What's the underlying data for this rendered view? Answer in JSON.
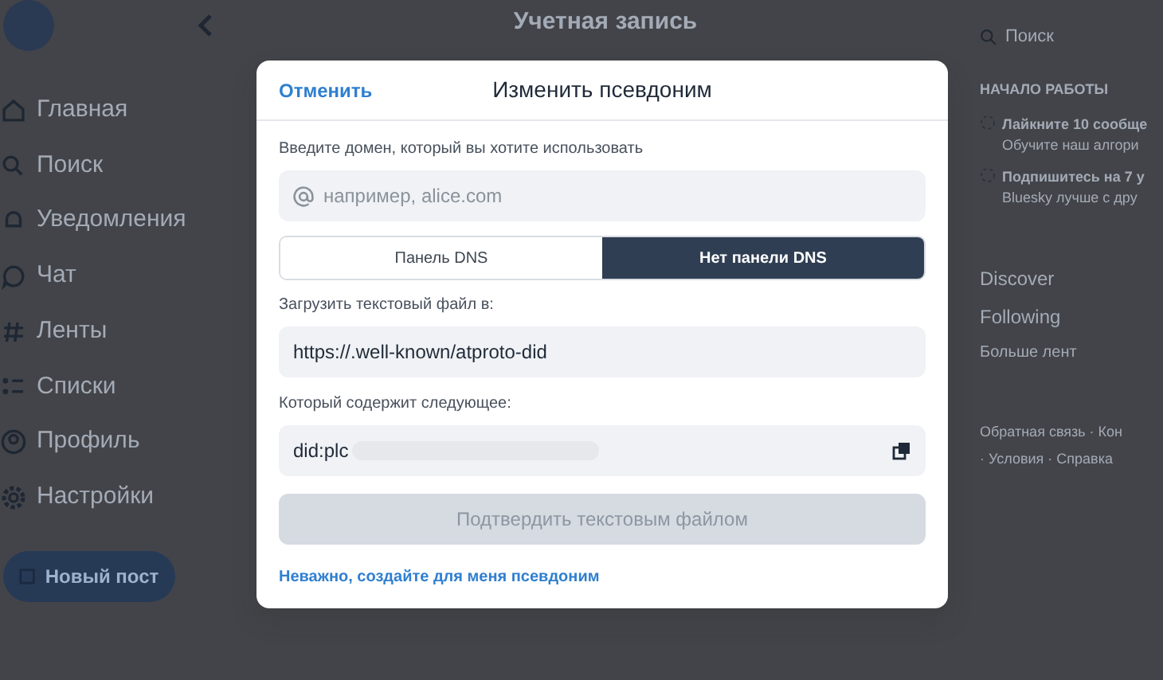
{
  "sidebar": {
    "items": [
      {
        "label": "Главная"
      },
      {
        "label": "Поиск"
      },
      {
        "label": "Уведомления"
      },
      {
        "label": "Чат"
      },
      {
        "label": "Ленты"
      },
      {
        "label": "Списки"
      },
      {
        "label": "Профиль"
      },
      {
        "label": "Настройки"
      }
    ],
    "new_post": "Новый пост"
  },
  "main": {
    "title": "Учетная запись"
  },
  "right": {
    "search_placeholder": "Поиск",
    "getting_started": {
      "heading": "НАЧАЛО РАБОТЫ",
      "tasks": [
        {
          "title": "Лайкните 10 сообще",
          "subtitle": "Обучите наш алгори"
        },
        {
          "title": "Подпишитесь на 7 у",
          "subtitle": "Bluesky лучше с дру"
        }
      ]
    },
    "feeds": [
      "Discover",
      "Following"
    ],
    "more_feeds": "Больше лент",
    "footer": [
      "Обратная связь · Кон",
      "· Условия · Справка"
    ]
  },
  "dialog": {
    "cancel": "Отменить",
    "title": "Изменить псевдоним",
    "domain_label": "Введите домен, который вы хотите использовать",
    "domain_field": {
      "placeholder": "например, alice.com"
    },
    "tabs": [
      {
        "label": "Панель DNS",
        "selected": false
      },
      {
        "label": "Нет панели DNS",
        "selected": true
      }
    ],
    "upload_label": "Загрузить текстовый файл в:",
    "upload_url": "https://.well-known/atproto-did",
    "contains_label": "Который содержит следующее:",
    "did_value": "did:plc",
    "confirm": {
      "label": "Подтвердить текстовым файлом",
      "disabled": true
    },
    "auto_link": "Неважно, создайте для меня псевдоним"
  }
}
